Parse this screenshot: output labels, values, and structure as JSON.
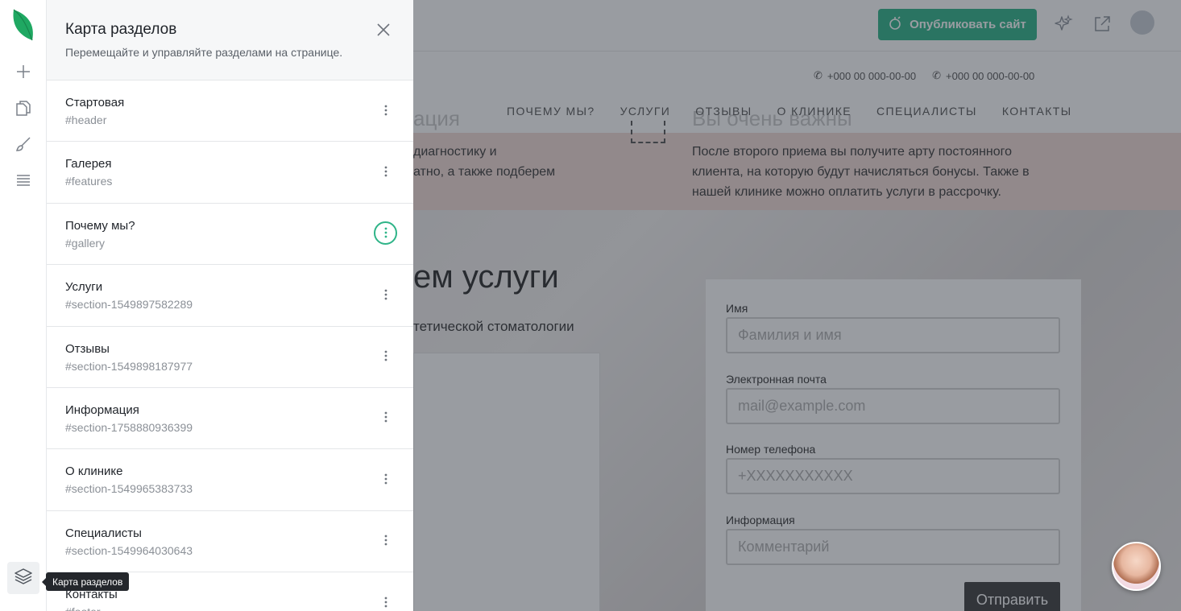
{
  "panel": {
    "title": "Карта разделов",
    "subtitle": "Перемещайте и управляйте разделами на странице.",
    "sections": [
      {
        "name": "Стартовая",
        "anchor": "#header"
      },
      {
        "name": "Галерея",
        "anchor": "#features"
      },
      {
        "name": "Почему мы?",
        "anchor": "#gallery",
        "active": true
      },
      {
        "name": "Услуги",
        "anchor": "#section-1549897582289"
      },
      {
        "name": "Отзывы",
        "anchor": "#section-1549898187977"
      },
      {
        "name": "Информация",
        "anchor": "#section-1758880936399"
      },
      {
        "name": "О клинике",
        "anchor": "#section-1549965383733"
      },
      {
        "name": "Специалисты",
        "anchor": "#section-1549964030643"
      },
      {
        "name": "Контакты",
        "anchor": "#footer"
      }
    ]
  },
  "tooltip": "Карта разделов",
  "rail": {
    "icons": [
      "leaf-logo-icon",
      "plus-icon",
      "pages-icon",
      "brush-icon",
      "list-icon",
      "layers-icon"
    ]
  },
  "topbar": {
    "publish_label": "Опубликовать сайт",
    "icons": [
      "sparkle-icon",
      "external-link-icon",
      "user-avatar-icon"
    ]
  },
  "site": {
    "phones": [
      "+000 00 000-00-00",
      "+000 00 000-00-00"
    ],
    "nav": [
      "ПОЧЕМУ МЫ?",
      "УСЛУГИ",
      "ОТЗЫВЫ",
      "О КЛИНИКЕ",
      "СПЕЦИАЛИСТЫ",
      "КОНТАКТЫ"
    ],
    "band_left_title": "ация",
    "band_left_text_1": "диагностику и",
    "band_left_text_2": "атно, а также подберем",
    "band_right_title": "Вы очень важны",
    "band_right_text_1": "После второго приема вы получите арту постоянного",
    "band_right_text_2": "клиента, на которую будут начисляться бонусы. Также в",
    "band_right_text_3": "нашей клинике можно оплатить услуги в рассрочку.",
    "hero_title": "ем услуги",
    "hero_subtitle": "тетической стоматологии",
    "form": {
      "name_label": "Имя",
      "name_placeholder": "Фамилия и имя",
      "email_label": "Электронная почта",
      "email_placeholder": "mail@example.com",
      "phone_label": "Номер телефона",
      "phone_placeholder": "+XXXXXXXXXXX",
      "info_label": "Информация",
      "info_placeholder": "Комментарий",
      "submit_label": "Отправить"
    }
  },
  "colors": {
    "accent": "#2fb488",
    "overlay": "rgba(38,44,56,0.47)",
    "pink_band": "#f2dcd6"
  }
}
